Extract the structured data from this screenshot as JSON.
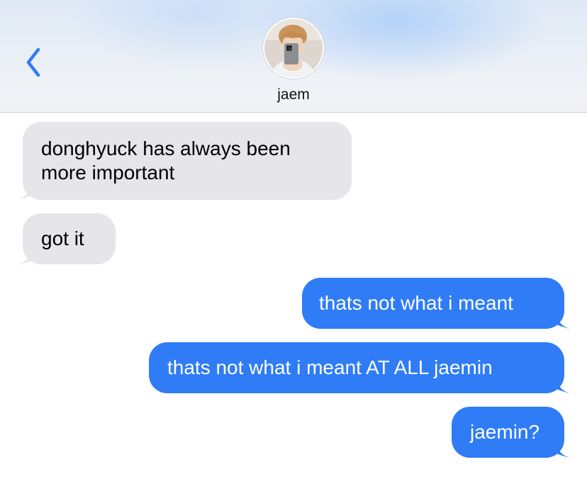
{
  "contact": {
    "name": "jaem"
  },
  "messages": [
    {
      "sender": "them",
      "text": "donghyuck has always been\nmore important"
    },
    {
      "sender": "them",
      "text": "got it"
    },
    {
      "sender": "me",
      "text": "thats not what i meant"
    },
    {
      "sender": "me",
      "text": "thats not what i meant AT ALL jaemin"
    },
    {
      "sender": "me",
      "text": "jaemin?"
    }
  ],
  "colors": {
    "outgoing_bubble": "#2f7cf6",
    "incoming_bubble": "#e5e5ea",
    "back_chevron": "#2f7cf6",
    "header_bg": "#eef1f6"
  },
  "icons": {
    "back": "chevron-left-icon",
    "avatar": "contact-photo"
  }
}
